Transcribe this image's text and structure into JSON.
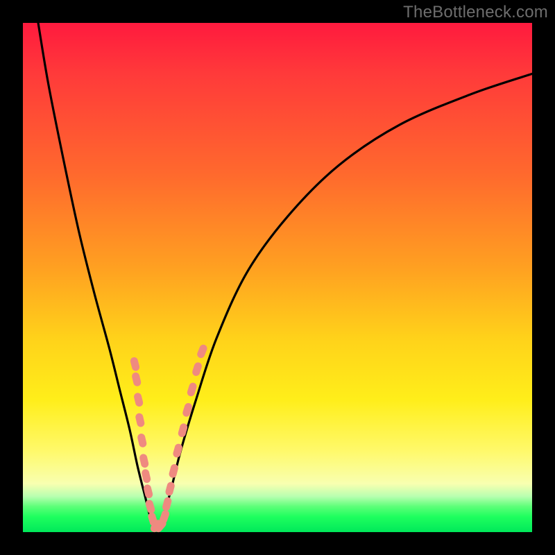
{
  "watermark": "TheBottleneck.com",
  "chart_data": {
    "type": "line",
    "title": "",
    "xlabel": "",
    "ylabel": "",
    "xlim": [
      0,
      100
    ],
    "ylim": [
      0,
      100
    ],
    "series": [
      {
        "name": "bottleneck-curve",
        "x": [
          3,
          5,
          8,
          11,
          14,
          17,
          19,
          21,
          22.5,
          24,
          25,
          25.8,
          26.5,
          27.5,
          29,
          31,
          34,
          38,
          44,
          52,
          62,
          74,
          88,
          100
        ],
        "y": [
          100,
          88,
          73,
          59,
          47,
          36,
          28,
          20,
          13,
          7,
          3,
          1,
          1,
          3,
          8,
          16,
          26,
          38,
          51,
          62,
          72,
          80,
          86,
          90
        ]
      }
    ],
    "markers": {
      "comment": "Salmon lozenge markers clustered near the V bottom on both arms",
      "points": [
        {
          "x": 22.0,
          "y": 33.0
        },
        {
          "x": 22.3,
          "y": 30.0
        },
        {
          "x": 22.7,
          "y": 26.0
        },
        {
          "x": 23.0,
          "y": 22.0
        },
        {
          "x": 23.4,
          "y": 18.0
        },
        {
          "x": 23.8,
          "y": 14.0
        },
        {
          "x": 24.2,
          "y": 11.0
        },
        {
          "x": 24.6,
          "y": 8.0
        },
        {
          "x": 25.0,
          "y": 5.0
        },
        {
          "x": 25.5,
          "y": 2.5
        },
        {
          "x": 26.2,
          "y": 1.2
        },
        {
          "x": 27.0,
          "y": 1.2
        },
        {
          "x": 27.8,
          "y": 3.0
        },
        {
          "x": 28.3,
          "y": 5.5
        },
        {
          "x": 28.9,
          "y": 8.5
        },
        {
          "x": 29.6,
          "y": 12.0
        },
        {
          "x": 30.4,
          "y": 16.0
        },
        {
          "x": 31.4,
          "y": 20.0
        },
        {
          "x": 32.3,
          "y": 24.0
        },
        {
          "x": 33.2,
          "y": 28.0
        },
        {
          "x": 34.2,
          "y": 32.0
        },
        {
          "x": 35.2,
          "y": 35.5
        }
      ]
    },
    "colors": {
      "curve": "#000000",
      "marker_fill": "#ef8a80",
      "gradient_top": "#ff1a3e",
      "gradient_mid": "#ffd21a",
      "gradient_bottom": "#00e85a"
    }
  }
}
